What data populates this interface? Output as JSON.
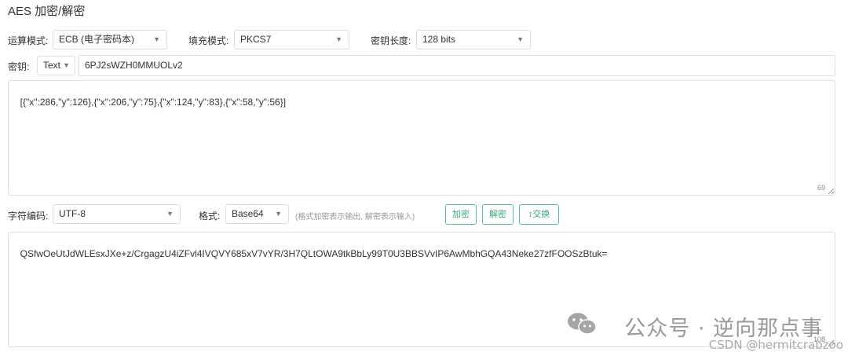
{
  "header": {
    "title": "AES 加密/解密"
  },
  "options": {
    "mode": {
      "label": "运算模式:",
      "value": "ECB (电子密码本)"
    },
    "padding": {
      "label": "填充模式:",
      "value": "PKCS7"
    },
    "key_length": {
      "label": "密钥长度:",
      "value": "128 bits"
    }
  },
  "key": {
    "label": "密钥:",
    "type": "Text",
    "value": "6PJ2sWZH0MMUOLv2"
  },
  "input": {
    "value": "[{\"x\":286,\"y\":126},{\"x\":206,\"y\":75},{\"x\":124,\"y\":83},{\"x\":58,\"y\":56}]",
    "char_count": "69"
  },
  "controls": {
    "encoding_label": "字符编码:",
    "encoding_value": "UTF-8",
    "format_label": "格式:",
    "format_value": "Base64",
    "format_hint": "(格式加密表示输出, 解密表示输入)",
    "encrypt_label": "加密",
    "decrypt_label": "解密",
    "swap_label": "交换",
    "swap_icon": "↕"
  },
  "output": {
    "value": "QSfwOeUtJdWLEsxJXe+z/CrgagzU4iZFvl4IVQVY685xV7vYR/3H7QLtOWA9tkBbLy99T0U3BBSVvIP6AwMbhGQA43Neke27zfFOOSzBtuk=",
    "char_count": "108"
  },
  "watermark": {
    "text": "公众号 · 逆向那点事",
    "credit": "CSDN @hermitcrabzoo"
  },
  "colors": {
    "accent": "#52c08d",
    "border": "#dcdfe6",
    "text": "#333333"
  },
  "icons": {
    "dropdown": "caret-down-icon",
    "wechat": "wechat-icon",
    "resize": "resize-grip-icon"
  }
}
